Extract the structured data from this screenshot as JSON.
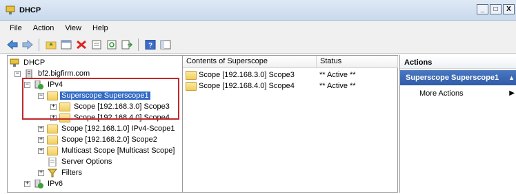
{
  "window": {
    "title": "DHCP",
    "controls": [
      "_",
      "□",
      "X"
    ]
  },
  "menu": [
    "File",
    "Action",
    "View",
    "Help"
  ],
  "toolbar": {
    "icons": [
      "back-arrow-icon",
      "forward-arrow-icon",
      "up-folder-icon",
      "properties-icon",
      "delete-icon",
      "export-icon",
      "refresh-icon",
      "export-list-icon",
      "help-icon",
      "show-hide-icon"
    ]
  },
  "tree": {
    "root": "DHCP",
    "server": "bf2.bigfirm.com",
    "ipv4": "IPv4",
    "superscope": "Superscope Superscope1",
    "scope3": "Scope [192.168.3.0] Scope3",
    "scope4": "Scope [192.168.4.0] Scope4",
    "scope1": "Scope [192.168.1.0] IPv4-Scope1",
    "scope2": "Scope [192.168.2.0] Scope2",
    "multicast": "Multicast Scope [Multicast Scope]",
    "server_options": "Server Options",
    "filters": "Filters",
    "ipv6": "IPv6"
  },
  "contents": {
    "columns": [
      "Contents of Superscope",
      "Status"
    ],
    "rows": [
      {
        "name": "Scope [192.168.3.0] Scope3",
        "status": "** Active **"
      },
      {
        "name": "Scope [192.168.4.0] Scope4",
        "status": "** Active **"
      }
    ]
  },
  "actions": {
    "header": "Actions",
    "section": "Superscope Superscope1",
    "more": "More Actions"
  }
}
